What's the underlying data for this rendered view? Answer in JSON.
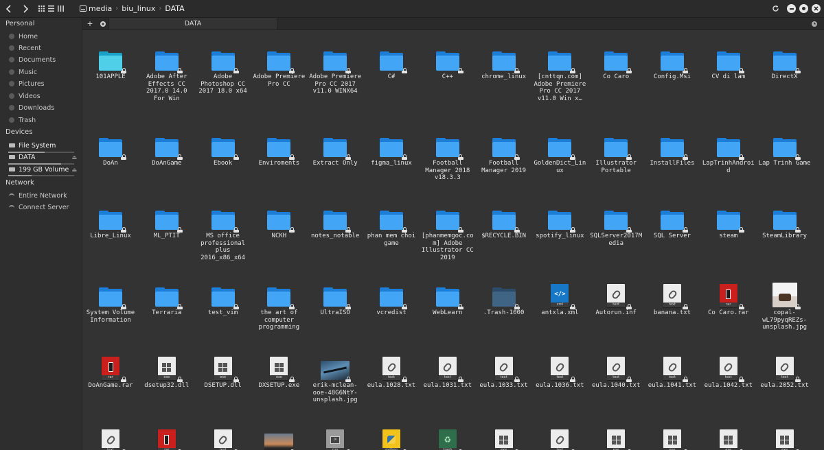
{
  "header": {
    "back_label": "‹",
    "forward_label": "›",
    "view_modes": [
      "icons-view",
      "list-view",
      "columns-view"
    ],
    "breadcrumb": [
      {
        "label": "media",
        "icon": "drive-icon"
      },
      {
        "label": "biu_linux"
      },
      {
        "label": "DATA"
      }
    ]
  },
  "sidebar": {
    "sections": [
      {
        "heading": "Personal",
        "items": [
          {
            "label": "Home",
            "icon": "home-icon"
          },
          {
            "label": "Recent",
            "icon": "recent-icon"
          },
          {
            "label": "Documents",
            "icon": "documents-icon"
          },
          {
            "label": "Music",
            "icon": "music-icon"
          },
          {
            "label": "Pictures",
            "icon": "pictures-icon"
          },
          {
            "label": "Videos",
            "icon": "videos-icon"
          },
          {
            "label": "Downloads",
            "icon": "downloads-icon"
          },
          {
            "label": "Trash",
            "icon": "trash-icon"
          }
        ]
      },
      {
        "heading": "Devices",
        "items": [
          {
            "label": "File System",
            "icon": "drive-icon",
            "usage": 0.55
          },
          {
            "label": "DATA",
            "icon": "drive-icon",
            "usage": 0.8,
            "selected": true
          },
          {
            "label": "199 GB Volume",
            "icon": "drive-icon",
            "usage": 0.35
          }
        ]
      },
      {
        "heading": "Network",
        "items": [
          {
            "label": "Entire Network",
            "icon": "network-icon"
          },
          {
            "label": "Connect Server",
            "icon": "network-icon"
          }
        ]
      }
    ]
  },
  "tabbar": {
    "new_tab_label": "+",
    "tab_label": "DATA"
  },
  "files": [
    {
      "name": "101APPLE",
      "kind": "folder-cyan"
    },
    {
      "name": "Adobe After Effects CC 2017.0 14.0 For Win",
      "kind": "folder"
    },
    {
      "name": "Adobe Photoshop CC 2017 18.0 x64",
      "kind": "folder"
    },
    {
      "name": "Adobe Premiere Pro CC",
      "kind": "folder"
    },
    {
      "name": "Adobe Premiere Pro CC 2017 v11.0 WINX64",
      "kind": "folder"
    },
    {
      "name": "C#",
      "kind": "folder"
    },
    {
      "name": "C++",
      "kind": "folder"
    },
    {
      "name": "chrome_linux",
      "kind": "folder"
    },
    {
      "name": "[cnttqn.com] Adobe Premiere Pro CC 2017 v11.0 Win x…",
      "kind": "folder"
    },
    {
      "name": "Co Caro",
      "kind": "folder"
    },
    {
      "name": "Config.Msi",
      "kind": "folder"
    },
    {
      "name": "CV di lam",
      "kind": "folder"
    },
    {
      "name": "DirectX",
      "kind": "folder"
    },
    {
      "name": "DoAn",
      "kind": "folder"
    },
    {
      "name": "DoAnGame",
      "kind": "folder"
    },
    {
      "name": "Ebook",
      "kind": "folder"
    },
    {
      "name": "Enviroments",
      "kind": "folder"
    },
    {
      "name": "Extract Only",
      "kind": "folder"
    },
    {
      "name": "figma_linux",
      "kind": "folder"
    },
    {
      "name": "Football Manager 2018 v18.3.3",
      "kind": "folder"
    },
    {
      "name": "Football Manager 2019",
      "kind": "folder"
    },
    {
      "name": "GoldenDict_Linux",
      "kind": "folder"
    },
    {
      "name": "Illustrator Portable",
      "kind": "folder"
    },
    {
      "name": "InstallFiles",
      "kind": "folder"
    },
    {
      "name": "LapTrinhAndroid",
      "kind": "folder"
    },
    {
      "name": "Lap Trinh Game",
      "kind": "folder"
    },
    {
      "name": "Libre_Linux",
      "kind": "folder"
    },
    {
      "name": "ML_PTIT",
      "kind": "folder"
    },
    {
      "name": "MS office professional plus 2016_x86_x64",
      "kind": "folder"
    },
    {
      "name": "NCKH",
      "kind": "folder"
    },
    {
      "name": "notes_notable",
      "kind": "folder"
    },
    {
      "name": "phan mem choi game",
      "kind": "folder"
    },
    {
      "name": "[phanmemgoc.com] Adobe Illustrator CC 2019",
      "kind": "folder"
    },
    {
      "name": "$RECYCLE.BIN",
      "kind": "folder"
    },
    {
      "name": "spotify_linux",
      "kind": "folder"
    },
    {
      "name": "SQLServer2017Media",
      "kind": "folder"
    },
    {
      "name": "SQL Server",
      "kind": "folder"
    },
    {
      "name": "steam",
      "kind": "folder"
    },
    {
      "name": "SteamLibrary",
      "kind": "folder"
    },
    {
      "name": "System Volume Information",
      "kind": "folder"
    },
    {
      "name": "Terraria",
      "kind": "folder"
    },
    {
      "name": "test_vim",
      "kind": "folder"
    },
    {
      "name": "the art of computer programming",
      "kind": "folder"
    },
    {
      "name": "UltraISO",
      "kind": "folder"
    },
    {
      "name": "vcredist",
      "kind": "folder"
    },
    {
      "name": "WebLearn",
      "kind": "folder"
    },
    {
      "name": ".Trash-1000",
      "kind": "folder-dim"
    },
    {
      "name": "antxla.xml",
      "kind": "xml",
      "ext": "xml"
    },
    {
      "name": "Autorun.inf",
      "kind": "text",
      "ext": "text"
    },
    {
      "name": "banana.txt",
      "kind": "text",
      "ext": "text"
    },
    {
      "name": "Co Caro.rar",
      "kind": "rar",
      "ext": "rar"
    },
    {
      "name": "copal-wL79pyqREZs-unsplash.jpg",
      "kind": "photo-bag"
    },
    {
      "name": "DoAnGame.rar",
      "kind": "rar",
      "ext": "rar"
    },
    {
      "name": "dsetup32.dll",
      "kind": "exe",
      "ext": "exe"
    },
    {
      "name": "DSETUP.dll",
      "kind": "exe",
      "ext": "exe"
    },
    {
      "name": "DXSETUP.exe",
      "kind": "exe",
      "ext": "exe"
    },
    {
      "name": "erik-mclean-ooe-48G6NtY-unsplash.jpg",
      "kind": "photo-bridge"
    },
    {
      "name": "eula.1028.txt",
      "kind": "text",
      "ext": "text"
    },
    {
      "name": "eula.1031.txt",
      "kind": "text",
      "ext": "text"
    },
    {
      "name": "eula.1033.txt",
      "kind": "text",
      "ext": "text"
    },
    {
      "name": "eula.1036.txt",
      "kind": "text",
      "ext": "text"
    },
    {
      "name": "eula.1040.txt",
      "kind": "text",
      "ext": "text"
    },
    {
      "name": "eula.1041.txt",
      "kind": "text",
      "ext": "text"
    },
    {
      "name": "eula.1042.txt",
      "kind": "text",
      "ext": "text"
    },
    {
      "name": "eula.2052.txt",
      "kind": "text",
      "ext": "text"
    },
    {
      "name": "",
      "kind": "text",
      "ext": "text"
    },
    {
      "name": "",
      "kind": "rar",
      "ext": "rar"
    },
    {
      "name": "",
      "kind": "text",
      "ext": "text"
    },
    {
      "name": "",
      "kind": "photo-sunset"
    },
    {
      "name": "",
      "kind": "run",
      "ext": "run"
    },
    {
      "name": "",
      "kind": "python",
      "ext": "python"
    },
    {
      "name": "",
      "kind": "trash",
      "ext": "trash"
    },
    {
      "name": "",
      "kind": "exe",
      "ext": "exe"
    },
    {
      "name": "",
      "kind": "text",
      "ext": "text"
    },
    {
      "name": "",
      "kind": "exe",
      "ext": "exe"
    },
    {
      "name": "",
      "kind": "exe",
      "ext": "exe"
    },
    {
      "name": "",
      "kind": "exe",
      "ext": "exe"
    },
    {
      "name": "",
      "kind": "exe",
      "ext": "exe"
    }
  ]
}
